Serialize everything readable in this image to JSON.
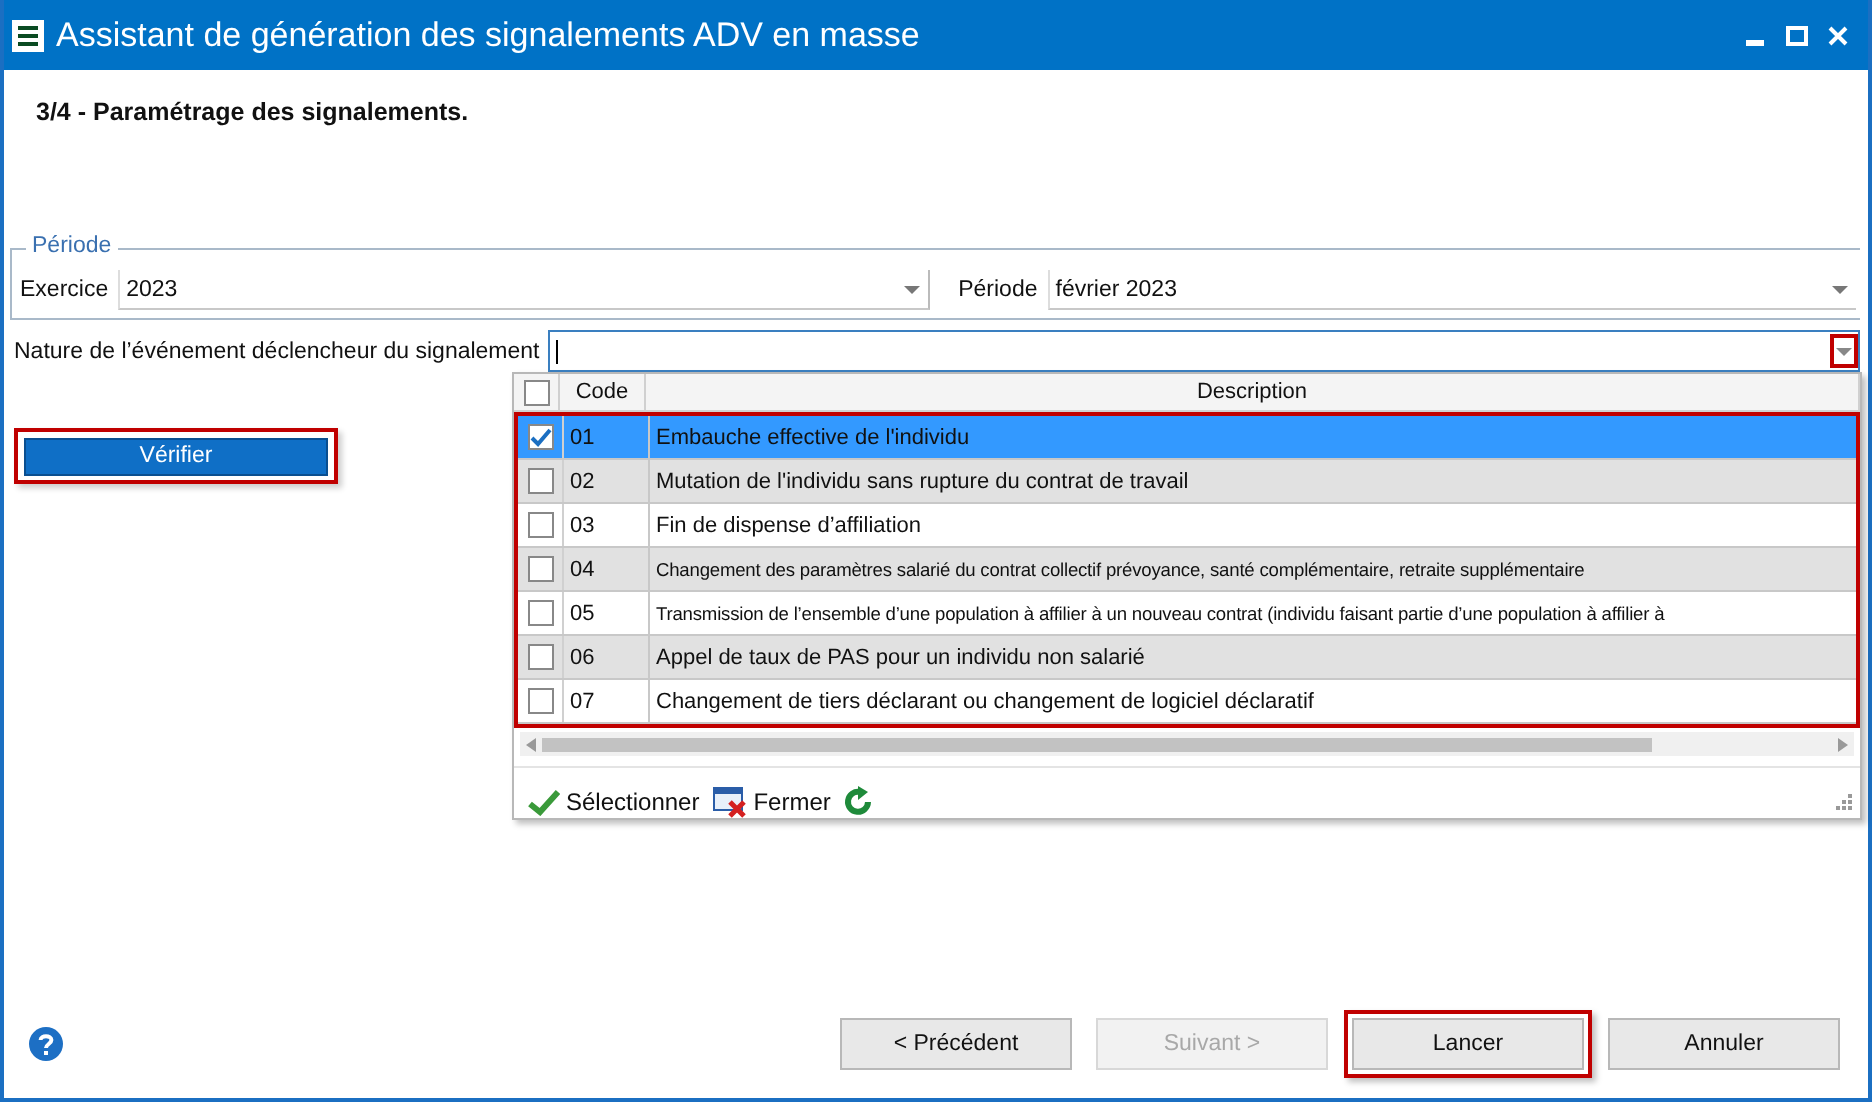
{
  "window": {
    "title": "Assistant de génération des signalements ADV en masse"
  },
  "step": "3/4 - Paramétrage des signalements.",
  "periode_group": {
    "title": "Période",
    "exercice": {
      "label": "Exercice",
      "value": "2023"
    },
    "periode": {
      "label": "Période",
      "value": "février 2023"
    }
  },
  "nature": {
    "label": "Nature de l’événement déclencheur du signalement",
    "arrow_highlighted": true
  },
  "verify_button": {
    "label": "Vérifier",
    "highlighted": true
  },
  "grid": {
    "columns": [
      "Code",
      "Description"
    ],
    "header_checked": false,
    "rows_highlighted": true,
    "rows": [
      {
        "code": "01",
        "description": "Embauche effective de l'individu",
        "checked": true,
        "selected": true
      },
      {
        "code": "02",
        "description": "Mutation de l'individu sans rupture du contrat de travail",
        "checked": false,
        "selected": false
      },
      {
        "code": "03",
        "description": "Fin de dispense d’affiliation",
        "checked": false,
        "selected": false
      },
      {
        "code": "04",
        "description": "Changement des paramètres salarié du contrat collectif prévoyance, santé complémentaire, retraite supplémentaire",
        "checked": false,
        "selected": false
      },
      {
        "code": "05",
        "description": "Transmission de l’ensemble d’une population à affilier à un nouveau contrat (individu faisant partie d’une population à affilier à",
        "checked": false,
        "selected": false
      },
      {
        "code": "06",
        "description": "Appel de taux de PAS pour un individu non salarié",
        "checked": false,
        "selected": false
      },
      {
        "code": "07",
        "description": "Changement de tiers déclarant ou changement de logiciel déclaratif",
        "checked": false,
        "selected": false
      }
    ],
    "toolbar": [
      {
        "kind": "select",
        "label": "Sélectionner"
      },
      {
        "kind": "close",
        "label": "Fermer"
      },
      {
        "kind": "refresh"
      }
    ]
  },
  "footer": {
    "buttons": [
      {
        "label": "< Précédent",
        "disabled": false,
        "highlighted": false
      },
      {
        "label": "Suivant >",
        "disabled": true,
        "highlighted": false
      },
      {
        "label": "Lancer",
        "disabled": false,
        "highlighted": true
      },
      {
        "label": "Annuler",
        "disabled": false,
        "highlighted": false
      }
    ]
  }
}
